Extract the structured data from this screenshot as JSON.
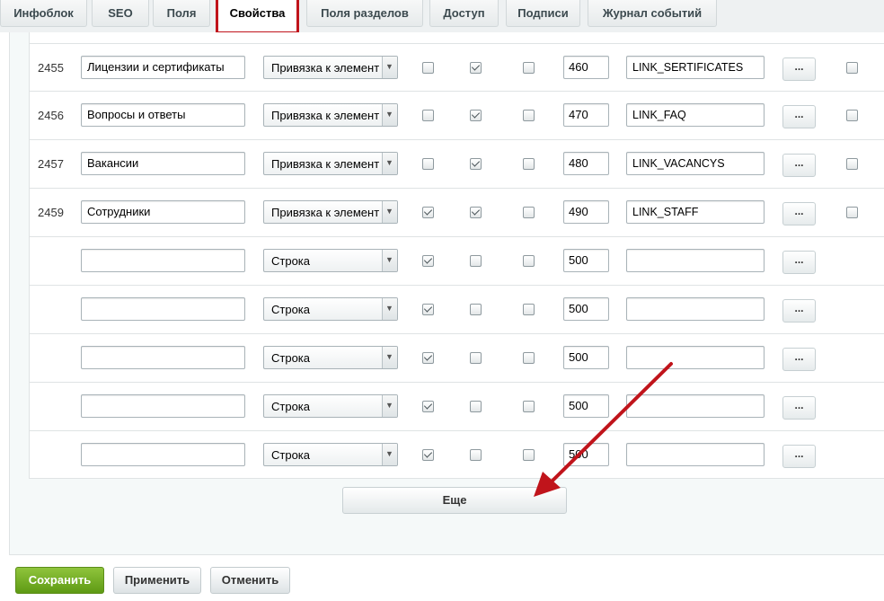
{
  "tabs": [
    {
      "label": "Инфоблок"
    },
    {
      "label": "SEO"
    },
    {
      "label": "Поля"
    },
    {
      "label": "Свойства"
    },
    {
      "label": "Поля разделов"
    },
    {
      "label": "Доступ"
    },
    {
      "label": "Подписи"
    },
    {
      "label": "Журнал событий"
    }
  ],
  "active_tab": "Свойства",
  "properties": [
    {
      "id": "2455",
      "name": "Лицензии и сертификаты",
      "type": "Привязка к элемент",
      "active": false,
      "multiple": true,
      "required": false,
      "sort": "460",
      "code": "LINK_SERTIFICATES",
      "more": "...",
      "delete": false
    },
    {
      "id": "2456",
      "name": "Вопросы и ответы",
      "type": "Привязка к элемент",
      "active": false,
      "multiple": true,
      "required": false,
      "sort": "470",
      "code": "LINK_FAQ",
      "more": "...",
      "delete": false
    },
    {
      "id": "2457",
      "name": "Вакансии",
      "type": "Привязка к элемент",
      "active": false,
      "multiple": true,
      "required": false,
      "sort": "480",
      "code": "LINK_VACANCYS",
      "more": "...",
      "delete": false
    },
    {
      "id": "2459",
      "name": "Сотрудники",
      "type": "Привязка к элемент",
      "active": true,
      "multiple": true,
      "required": false,
      "sort": "490",
      "code": "LINK_STAFF",
      "more": "...",
      "delete": false
    },
    {
      "id": "",
      "name": "",
      "type": "Строка",
      "active": true,
      "multiple": false,
      "required": false,
      "sort": "500",
      "code": "",
      "more": "..."
    },
    {
      "id": "",
      "name": "",
      "type": "Строка",
      "active": true,
      "multiple": false,
      "required": false,
      "sort": "500",
      "code": "",
      "more": "..."
    },
    {
      "id": "",
      "name": "",
      "type": "Строка",
      "active": true,
      "multiple": false,
      "required": false,
      "sort": "500",
      "code": "",
      "more": "..."
    },
    {
      "id": "",
      "name": "",
      "type": "Строка",
      "active": true,
      "multiple": false,
      "required": false,
      "sort": "500",
      "code": "",
      "more": "..."
    },
    {
      "id": "",
      "name": "",
      "type": "Строка",
      "active": true,
      "multiple": false,
      "required": false,
      "sort": "500",
      "code": "",
      "more": "..."
    }
  ],
  "more_button": "Еще",
  "buttons": {
    "save": "Сохранить",
    "apply": "Применить",
    "cancel": "Отменить"
  },
  "colors": {
    "highlight": "#c0141b",
    "save_button": "#6fa81e"
  }
}
